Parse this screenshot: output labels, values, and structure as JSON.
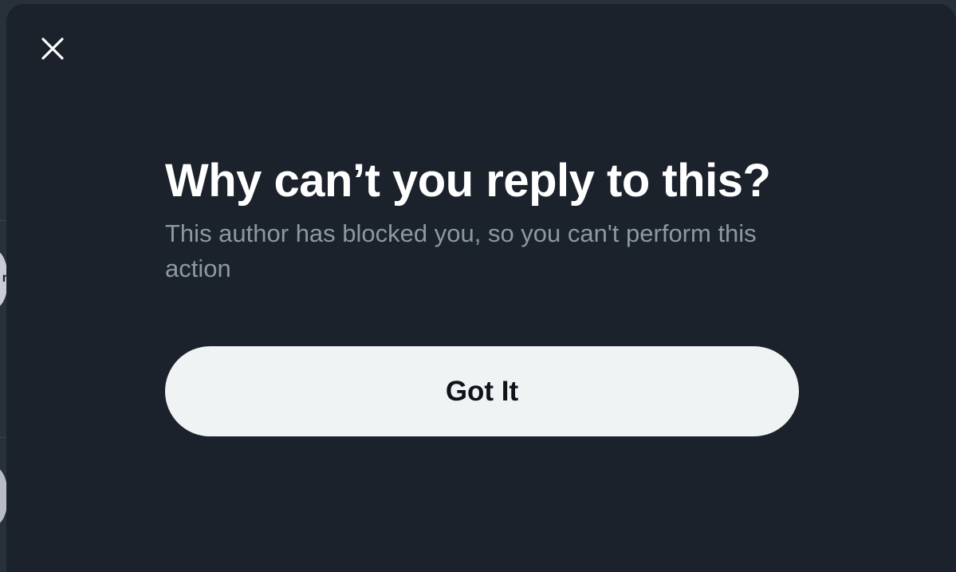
{
  "dialog": {
    "title": "Why can’t you reply to this?",
    "message": "This author has blocked you, so you can't perform this action",
    "confirm_label": "Got It",
    "close_icon": "close-icon"
  },
  "background": {
    "partial_letter": "r"
  },
  "colors": {
    "modal_background": "#1b222b",
    "title_text": "#ffffff",
    "message_text": "#8b98a5",
    "button_background": "#eff3f4",
    "button_text": "#0f1419"
  }
}
